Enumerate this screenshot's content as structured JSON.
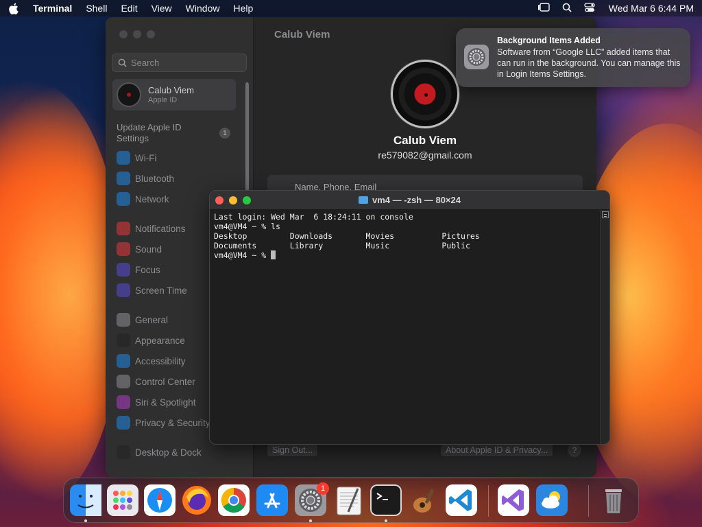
{
  "menubar": {
    "app_name": "Terminal",
    "items": [
      "Shell",
      "Edit",
      "View",
      "Window",
      "Help"
    ],
    "clock": "Wed Mar 6  6:44 PM"
  },
  "settings": {
    "search_placeholder": "Search",
    "account": {
      "name": "Calub Viem",
      "subtitle": "Apple ID"
    },
    "update": {
      "label": "Update Apple ID Settings",
      "badge": "1"
    },
    "sidebar_items": [
      {
        "label": "Wi-Fi",
        "icon": "wifi-icon",
        "color": "#1f87e8"
      },
      {
        "label": "Bluetooth",
        "icon": "bluetooth-icon",
        "color": "#1f87e8"
      },
      {
        "label": "Network",
        "icon": "globe-icon",
        "color": "#1f87e8"
      },
      {
        "label": "Notifications",
        "icon": "bell-icon",
        "color": "#e8373b"
      },
      {
        "label": "Sound",
        "icon": "speaker-icon",
        "color": "#e8373b"
      },
      {
        "label": "Focus",
        "icon": "moon-icon",
        "color": "#5a4ad6"
      },
      {
        "label": "Screen Time",
        "icon": "hourglass-icon",
        "color": "#5a4ad6"
      },
      {
        "label": "General",
        "icon": "gear-icon",
        "color": "#8e8e93"
      },
      {
        "label": "Appearance",
        "icon": "appearance-icon",
        "color": "#222222"
      },
      {
        "label": "Accessibility",
        "icon": "accessibility-icon",
        "color": "#1f87e8"
      },
      {
        "label": "Control Center",
        "icon": "control-center-icon",
        "color": "#8e8e93"
      },
      {
        "label": "Siri & Spotlight",
        "icon": "siri-icon",
        "color": "#b13cc9"
      },
      {
        "label": "Privacy & Security",
        "icon": "hand-icon",
        "color": "#1f87e8"
      },
      {
        "label": "Desktop & Dock",
        "icon": "dock-icon",
        "color": "#222222"
      }
    ],
    "content": {
      "title": "Calub Viem",
      "profile_name": "Calub Viem",
      "email": "re579082@gmail.com",
      "row_partial": "Name, Phone, Email",
      "sign_out": "Sign Out...",
      "about": "About Apple ID & Privacy...",
      "help": "?"
    }
  },
  "notification": {
    "title": "Background Items Added",
    "body": "Software from “Google LLC” added items that can run in the background. You can manage this in Login Items Settings."
  },
  "terminal": {
    "title": "vm4 — -zsh — 80×24",
    "lines": [
      "Last login: Wed Mar  6 18:24:11 on console",
      "vm4@VM4 ~ % ls",
      "Desktop         Downloads       Movies          Pictures",
      "Documents       Library         Music           Public",
      "vm4@VM4 ~ % "
    ]
  },
  "dock": {
    "apps": [
      {
        "name": "Finder",
        "icon": "finder-icon",
        "color": "#2a8cf0",
        "running": true
      },
      {
        "name": "Launchpad",
        "icon": "launchpad-icon",
        "color": "#e9e9ee",
        "running": false
      },
      {
        "name": "Safari",
        "icon": "safari-icon",
        "color": "#1a8ef5",
        "running": false
      },
      {
        "name": "Firefox",
        "icon": "firefox-icon",
        "color": "#ff7a1a",
        "running": false
      },
      {
        "name": "Chrome",
        "icon": "chrome-icon",
        "color": "#ffffff",
        "running": false
      },
      {
        "name": "App Store",
        "icon": "appstore-icon",
        "color": "#1e8bf5",
        "running": false
      },
      {
        "name": "System Settings",
        "icon": "system-settings-icon",
        "color": "#8e8e93",
        "running": true,
        "badge": "1"
      },
      {
        "name": "TextEdit",
        "icon": "textedit-icon",
        "color": "#f3f3f3",
        "running": false
      },
      {
        "name": "Terminal",
        "icon": "terminal-icon",
        "color": "#1b1b1b",
        "running": true
      },
      {
        "name": "Instruments",
        "icon": "instruments-icon",
        "color": "#5a3a2a",
        "running": false
      },
      {
        "name": "Visual Studio Code",
        "icon": "vscode-icon",
        "color": "#ffffff",
        "running": false
      },
      {
        "name": "Visual Studio",
        "icon": "visual-studio-icon",
        "color": "#ffffff",
        "running": false
      },
      {
        "name": "Weather",
        "icon": "weather-icon",
        "color": "#2b86e0",
        "running": false
      },
      {
        "name": "Trash",
        "icon": "trash-icon",
        "color": "#9a9a9e",
        "running": false
      }
    ]
  }
}
